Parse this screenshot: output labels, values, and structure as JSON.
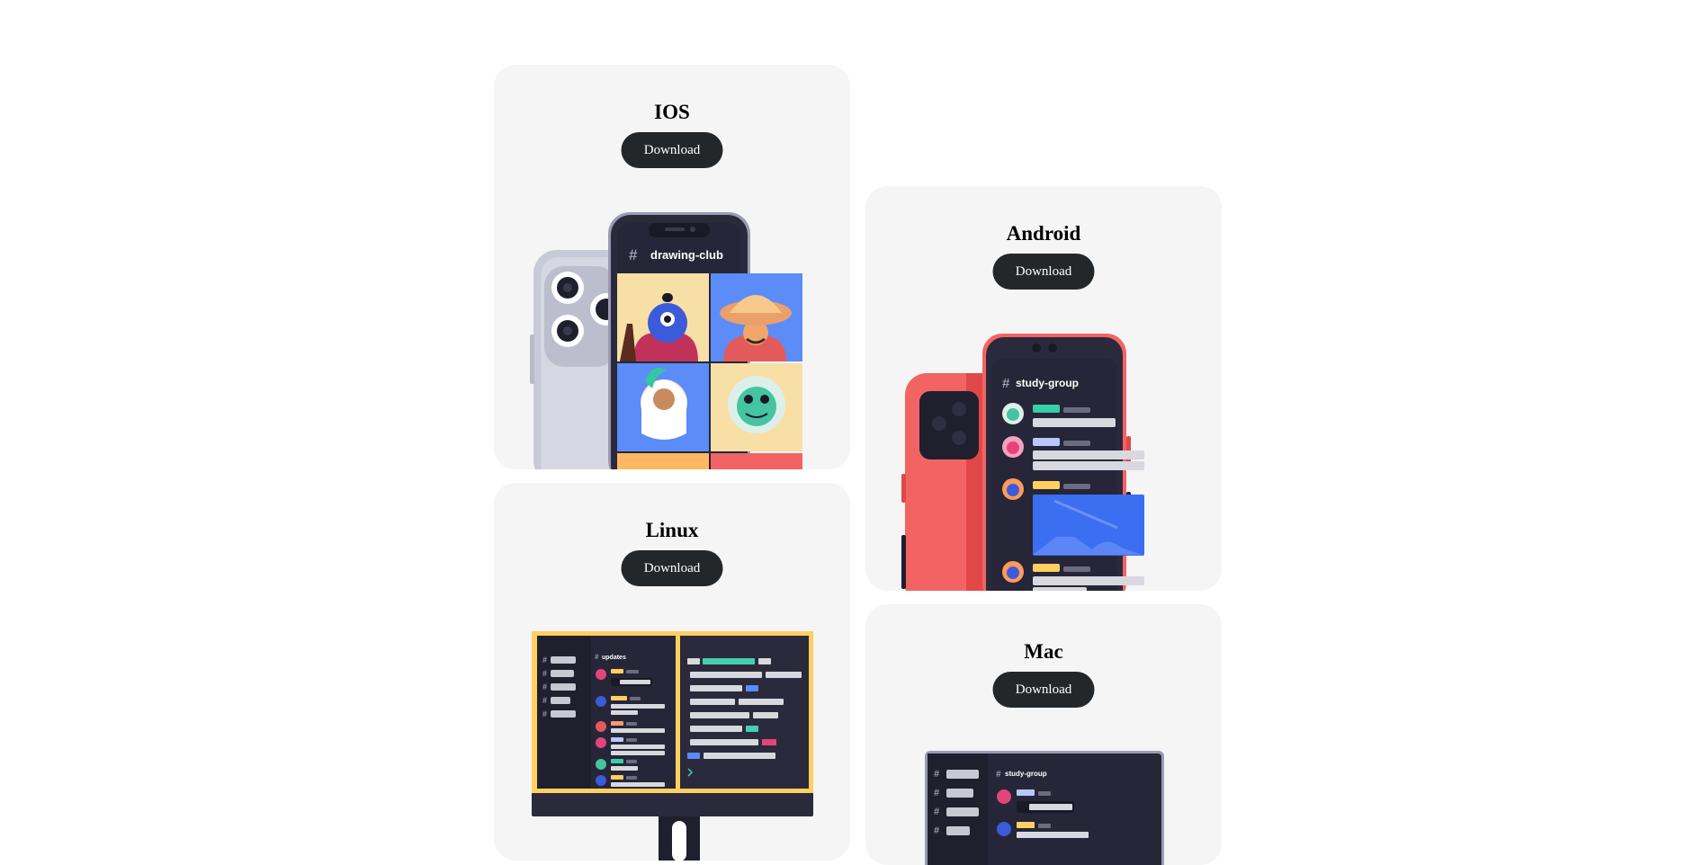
{
  "platforms": [
    {
      "title": "IOS",
      "button_label": "Download",
      "channel": "drawing-club"
    },
    {
      "title": "Android",
      "button_label": "Download",
      "channel": "study-group"
    },
    {
      "title": "Linux",
      "button_label": "Download",
      "channel": "updates"
    },
    {
      "title": "Mac",
      "button_label": "Download",
      "channel": "study-group"
    }
  ],
  "colors": {
    "card_bg": "#f5f5f5",
    "button_bg": "#23272a",
    "button_text": "#ffffff",
    "app_dark": "#262638",
    "android_red": "#f26463",
    "linux_yellow": "#ffcf61"
  }
}
